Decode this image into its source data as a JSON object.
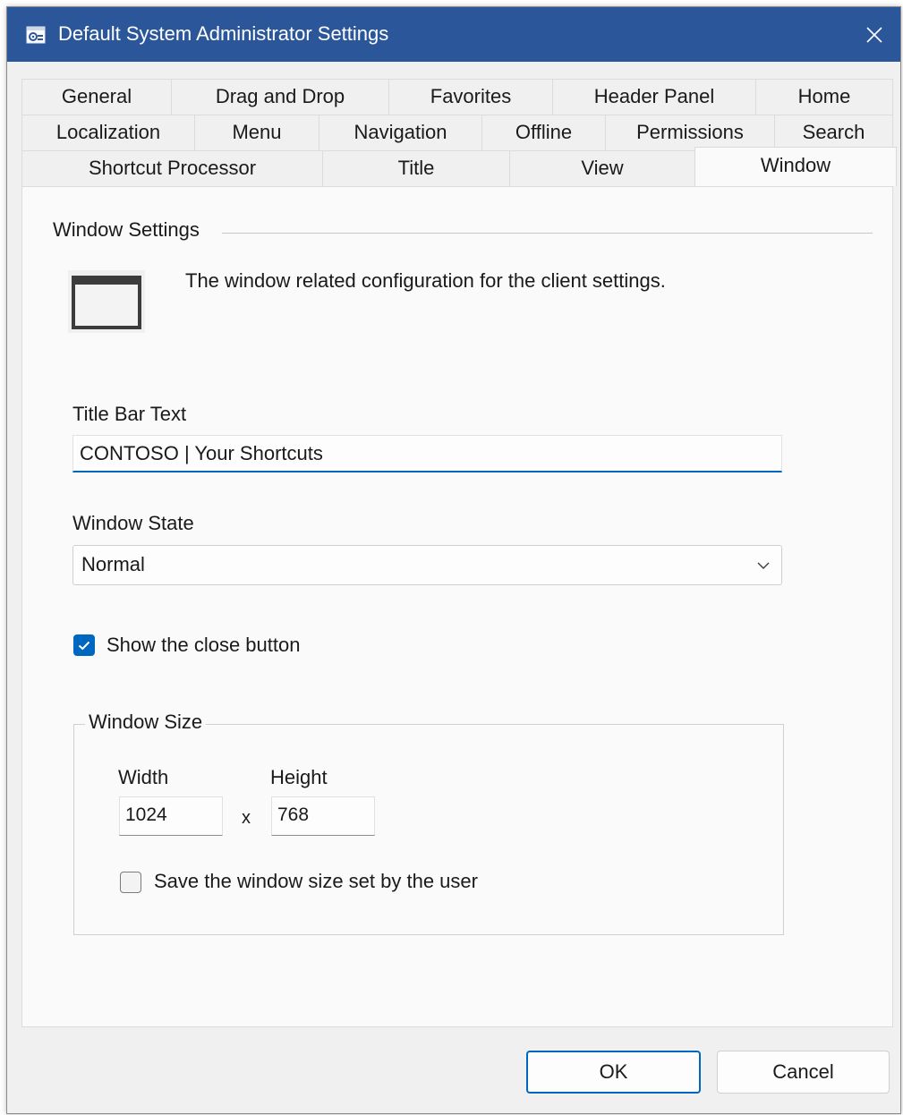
{
  "window": {
    "title": "Default System Administrator Settings",
    "app_icon": "settings-window-icon",
    "close_icon": "close-icon",
    "title_bar_color": "#2b579a"
  },
  "tabs": {
    "row1": [
      "General",
      "Drag and Drop",
      "Favorites",
      "Header Panel",
      "Home"
    ],
    "row2": [
      "Localization",
      "Menu",
      "Navigation",
      "Offline",
      "Permissions",
      "Search"
    ],
    "row3": [
      "Shortcut Processor",
      "Title",
      "View",
      "Window"
    ],
    "active": "Window"
  },
  "page": {
    "group_title": "Window Settings",
    "description": "The window related configuration for the client settings.",
    "icon": "window-icon"
  },
  "form": {
    "title_bar_text_label": "Title Bar Text",
    "title_bar_text_value": "CONTOSO | Your Shortcuts",
    "window_state_label": "Window State",
    "window_state_value": "Normal",
    "show_close_label": "Show the close button",
    "show_close_checked": true
  },
  "window_size": {
    "legend": "Window Size",
    "width_label": "Width",
    "width_value": "1024",
    "separator": "x",
    "height_label": "Height",
    "height_value": "768",
    "save_size_label": "Save the window size set by the user",
    "save_size_checked": false
  },
  "buttons": {
    "ok": "OK",
    "cancel": "Cancel"
  },
  "colors": {
    "accent": "#0067c0"
  }
}
